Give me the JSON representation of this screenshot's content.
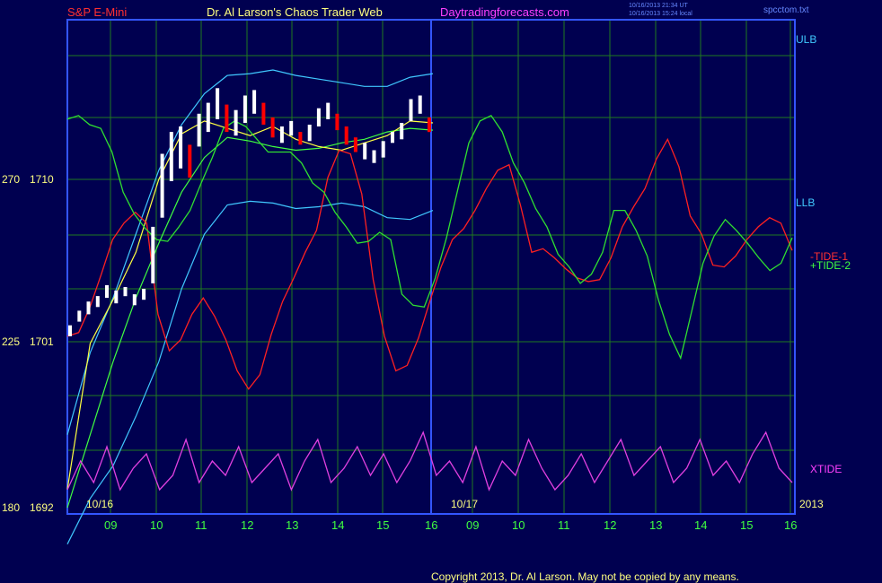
{
  "header": {
    "instrument": "S&P E-Mini",
    "site_title": "Dr. Al Larson's Chaos Trader Web",
    "site_url": "Daytradingforecasts.com",
    "ts_utc": "10/16/2013 21:34 UT",
    "ts_local": "10/16/2013 15:24 local",
    "file": "spcctom.txt"
  },
  "footer": {
    "copyright": "Copyright 2013, Dr. Al Larson. May not be copied by any means."
  },
  "colors": {
    "background": "#000050",
    "grid": "#1f7a1f",
    "axis_frame": "#3355ff",
    "price": "#ffffff",
    "price_down": "#ff0000",
    "ma_fast": "#ffff40",
    "ma_slow": "#40ff40",
    "bands": "#40c8ff",
    "tide1": "#ff2020",
    "tide2": "#30e030",
    "xtide": "#e040e0",
    "label_red": "#ff3030",
    "label_yellow": "#ffff80",
    "label_magenta": "#ff40ff"
  },
  "chart_data": {
    "type": "line",
    "title": "S&P E-Mini",
    "y_ticks": [
      {
        "left": "270",
        "right": "1710",
        "price": 1710
      },
      {
        "left": "225",
        "right": "1701",
        "price": 1701
      },
      {
        "left": "180",
        "right": "1692",
        "price": 1692
      }
    ],
    "ylim": [
      1692,
      1715
    ],
    "x_ticks": [
      "09",
      "10",
      "11",
      "12",
      "13",
      "14",
      "15",
      "16",
      "09",
      "10",
      "11",
      "12",
      "13",
      "14",
      "15",
      "16"
    ],
    "day_labels": [
      "10/16",
      "10/17"
    ],
    "year_label": "2013",
    "series_labels": {
      "ulb": "ULB",
      "llb": "LLB",
      "tide1": "-TIDE-1",
      "tide2": "+TIDE-2",
      "xtide": "XTIDE"
    },
    "price_bars_approx": [
      [
        1701.4,
        1702.0
      ],
      [
        1702.2,
        1702.8
      ],
      [
        1702.6,
        1703.3
      ],
      [
        1703.0,
        1703.6
      ],
      [
        1703.5,
        1704.2
      ],
      [
        1703.2,
        1703.9
      ],
      [
        1703.6,
        1704.1
      ],
      [
        1703.1,
        1703.7
      ],
      [
        1703.4,
        1704.0
      ],
      [
        1704.3,
        1707.4
      ],
      [
        1707.9,
        1711.4
      ],
      [
        1709.9,
        1712.6
      ],
      [
        1710.6,
        1712.9
      ],
      [
        1710.1,
        1711.9
      ],
      [
        1711.8,
        1713.6
      ],
      [
        1712.6,
        1714.2
      ],
      [
        1713.3,
        1715.0
      ],
      [
        1712.6,
        1714.1
      ],
      [
        1712.4,
        1713.8
      ],
      [
        1713.1,
        1714.6
      ],
      [
        1713.6,
        1714.9
      ],
      [
        1713.0,
        1714.2
      ],
      [
        1712.3,
        1713.4
      ],
      [
        1712.0,
        1712.9
      ],
      [
        1712.4,
        1713.2
      ],
      [
        1711.9,
        1712.6
      ],
      [
        1712.1,
        1713.0
      ],
      [
        1712.9,
        1713.9
      ],
      [
        1713.3,
        1714.2
      ],
      [
        1712.7,
        1713.6
      ],
      [
        1711.9,
        1712.9
      ],
      [
        1711.5,
        1712.3
      ],
      [
        1711.1,
        1712.0
      ],
      [
        1710.9,
        1711.6
      ],
      [
        1711.2,
        1712.1
      ],
      [
        1712.0,
        1712.6
      ],
      [
        1712.2,
        1713.1
      ],
      [
        1713.2,
        1714.4
      ],
      [
        1713.6,
        1714.6
      ],
      [
        1712.6,
        1713.4
      ]
    ],
    "moving_avg_fast_approx": [
      1693,
      1701,
      1703.4,
      1706,
      1710,
      1712.5,
      1713.2,
      1712.8,
      1712.4,
      1712.9,
      1712.2,
      1711.8,
      1711.6,
      1712.0,
      1712.4,
      1713.2,
      1713.1
    ],
    "moving_avg_slow_approx": [
      1692,
      1696,
      1700,
      1703.5,
      1706.5,
      1709.3,
      1711.2,
      1712.3,
      1712.1,
      1711.8,
      1711.6,
      1711.7,
      1712.0,
      1712.2,
      1712.6,
      1712.8,
      1712.7
    ],
    "upper_band_approx": [
      1696,
      1700.5,
      1703.5,
      1707,
      1710.5,
      1713,
      1714.7,
      1715.7,
      1715.8,
      1716.0,
      1715.7,
      1715.5,
      1715.3,
      1715.1,
      1715.1,
      1715.6,
      1715.8
    ],
    "lower_band_approx": [
      1690.0,
      1692.5,
      1694.3,
      1697,
      1700,
      1704,
      1707,
      1708.6,
      1708.8,
      1708.7,
      1708.4,
      1708.5,
      1708.7,
      1708.5,
      1707.9,
      1707.8,
      1708.3
    ],
    "tide1_approx": [
      1701.4,
      1701.6,
      1703,
      1704.8,
      1706.7,
      1707.6,
      1708.2,
      1707.6,
      1702.6,
      1700.6,
      1701.2,
      1702.6,
      1703.5,
      1702.5,
      1701.2,
      1699.5,
      1698.5,
      1699.3,
      1701.5,
      1703.3,
      1704.6,
      1706,
      1707.2,
      1710.1,
      1711.6,
      1711.4,
      1709.2,
      1704.5,
      1701.4,
      1699.5,
      1699.8,
      1701.3,
      1703.3,
      1705.2,
      1706.7,
      1707.3,
      1708.3,
      1709.5,
      1710.5,
      1710.8,
      1708.6,
      1706.0,
      1706.2,
      1705.7,
      1705.1,
      1704.6,
      1704.4,
      1704.5,
      1705.7,
      1707.4,
      1708.5,
      1709.5,
      1711.1,
      1712.2,
      1710.7,
      1708.0,
      1707.0,
      1705.3,
      1705.2,
      1705.8,
      1706.7,
      1707.4,
      1707.9,
      1707.6,
      1706.1
    ],
    "tide2_approx": [
      1713.3,
      1713.5,
      1713.0,
      1712.8,
      1711.5,
      1709.3,
      1708.1,
      1707.3,
      1706.7,
      1706.6,
      1707.4,
      1708.3,
      1709.8,
      1711.2,
      1712.8,
      1713.2,
      1712.9,
      1712.2,
      1711.5,
      1711.5,
      1711.5,
      1710.9,
      1709.8,
      1709.3,
      1708.2,
      1707.4,
      1706.5,
      1706.6,
      1707.1,
      1706.7,
      1703.7,
      1703.1,
      1703.0,
      1704.6,
      1706.8,
      1709.4,
      1712.0,
      1713.2,
      1713.5,
      1712.6,
      1710.9,
      1709.8,
      1708.4,
      1707.4,
      1705.9,
      1705.2,
      1704.3,
      1704.8,
      1706.0,
      1708.3,
      1708.3,
      1707.2,
      1705.8,
      1703.4,
      1701.5,
      1700.2,
      1702.8,
      1705.4,
      1706.9,
      1707.8,
      1707.2,
      1706.5,
      1705.7,
      1705.0,
      1705.4,
      1706.8
    ],
    "xtide_approx_units": [
      0.2,
      0.6,
      0.3,
      0.8,
      0.2,
      0.5,
      0.7,
      0.2,
      0.4,
      0.9,
      0.3,
      0.6,
      0.4,
      0.8,
      0.3,
      0.5,
      0.7,
      0.2,
      0.6,
      0.9,
      0.3,
      0.5,
      0.8,
      0.4,
      0.7,
      0.3,
      0.6,
      1.0,
      0.4,
      0.6,
      0.3,
      0.8,
      0.2,
      0.6,
      0.4,
      0.9,
      0.5,
      0.2,
      0.4,
      0.7,
      0.3,
      0.6,
      0.9,
      0.4,
      0.6,
      0.8,
      0.3,
      0.5,
      0.9,
      0.4,
      0.6,
      0.3,
      0.7,
      1.0,
      0.5,
      0.3
    ]
  }
}
